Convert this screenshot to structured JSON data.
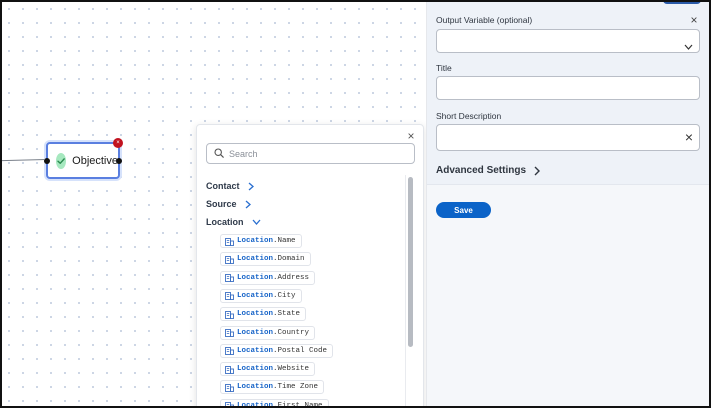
{
  "canvas": {
    "node": {
      "label": "Objective",
      "badge": "×"
    }
  },
  "picker": {
    "close_glyph": "×",
    "search": {
      "placeholder": "Search",
      "value": ""
    },
    "groups": [
      {
        "label": "Contact",
        "state": "collapsed"
      },
      {
        "label": "Source",
        "state": "collapsed"
      },
      {
        "label": "Location",
        "state": "expanded"
      }
    ],
    "items": [
      {
        "prefix": "Location",
        "field": ".Name"
      },
      {
        "prefix": "Location",
        "field": ".Domain"
      },
      {
        "prefix": "Location",
        "field": ".Address"
      },
      {
        "prefix": "Location",
        "field": ".City"
      },
      {
        "prefix": "Location",
        "field": ".State"
      },
      {
        "prefix": "Location",
        "field": ".Country"
      },
      {
        "prefix": "Location",
        "field": ".Postal Code"
      },
      {
        "prefix": "Location",
        "field": ".Website"
      },
      {
        "prefix": "Location",
        "field": ".Time Zone"
      },
      {
        "prefix": "Location",
        "field": ".First Name"
      }
    ]
  },
  "panel": {
    "close_glyph": "×",
    "output_variable": {
      "label": "Output Variable (optional)",
      "value": ""
    },
    "title": {
      "label": "Title",
      "value": ""
    },
    "short_description": {
      "label": "Short Description",
      "value": "",
      "clear_glyph": "×"
    },
    "advanced_label": "Advanced Settings",
    "save_label": "Save"
  },
  "colors": {
    "accent": "#0b63c8",
    "variable_prefix": "#1764c8",
    "node_border": "#5a7fe0",
    "success": "#a6e8bf",
    "error_badge": "#c1121f"
  }
}
